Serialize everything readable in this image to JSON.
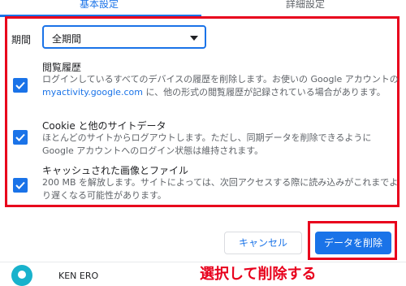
{
  "tabs": {
    "basic": "基本設定",
    "advanced": "詳細設定"
  },
  "period": {
    "label": "期間",
    "value": "全期間"
  },
  "items": [
    {
      "title": "閲覧履歴",
      "desc_before": "ログインしているすべてのデバイスの履歴を削除します。お使いの Google アカウントの ",
      "link": "myactivity.google.com",
      "desc_after": " に、他の形式の閲覧履歴が記録されている場合があります。",
      "checked": true
    },
    {
      "title": "Cookie と他のサイトデータ",
      "desc": "ほとんどのサイトからログアウトします。ただし、同期データを削除できるように Google アカウントへのログイン状態は維持されます。",
      "checked": true
    },
    {
      "title": "キャッシュされた画像とファイル",
      "desc": "200 MB を解放します。サイトによっては、次回アクセスする際に読み込みがこれまでより遅くなる可能性があります。",
      "checked": true
    }
  ],
  "buttons": {
    "cancel": "キャンセル",
    "delete": "データを削除"
  },
  "annotation": "選択して削除する",
  "account": {
    "name": "KEN ERO"
  },
  "colors": {
    "accent": "#1a73e8",
    "highlight": "#e8001c",
    "avatar": "#18b2cc"
  }
}
